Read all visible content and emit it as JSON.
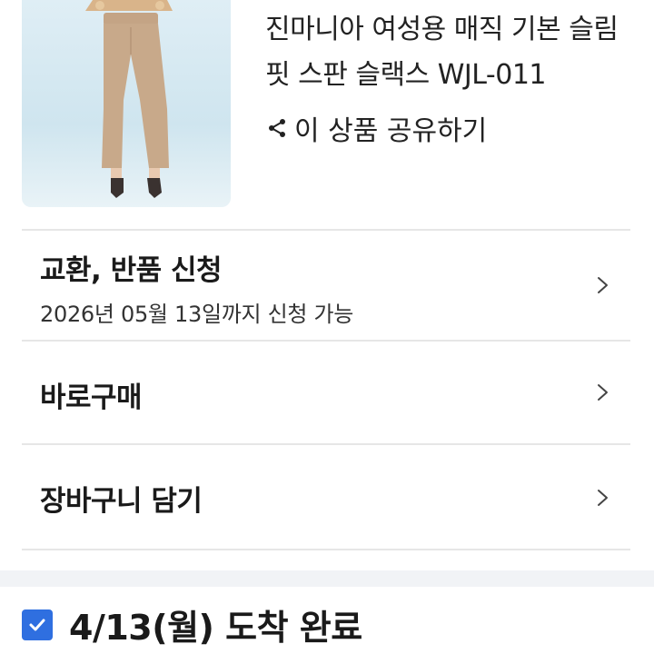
{
  "product": {
    "name": "진마니아 여성용 매직 기본 슬림핏 스판 슬랙스 WJL-011",
    "share_label": "이 상품 공유하기",
    "image_alt": "beige-slacks-photo"
  },
  "actions": [
    {
      "id": "exchange-return",
      "title": "교환, 반품 신청",
      "subtitle": "2026년 05월 13일까지 신청 가능"
    },
    {
      "id": "buy-now",
      "title": "바로구매"
    },
    {
      "id": "add-to-cart",
      "title": "장바구니 담기"
    }
  ],
  "delivery": {
    "status": "4/13(월) 도착 완료",
    "checked": true
  },
  "colors": {
    "accent": "#2f6fe0",
    "divider": "#e6e6e6",
    "section_bg": "#f1f3f6",
    "slacks": "#c8a98a"
  }
}
